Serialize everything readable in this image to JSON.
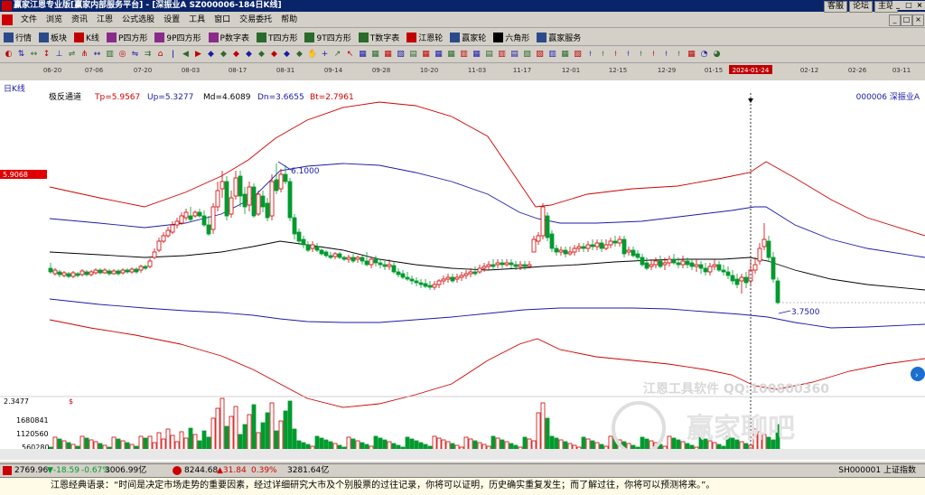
{
  "window": {
    "title": "赢家江恩专业版[赢家内部服务平台] - [深振业A  SZ000006-184日K线]",
    "links": [
      "客服",
      "论坛",
      "主站"
    ],
    "controls": [
      "_",
      "□",
      "×"
    ]
  },
  "menu": {
    "items": [
      "文件",
      "浏览",
      "资讯",
      "江恩",
      "公式选股",
      "设置",
      "工具",
      "窗口",
      "交易委托",
      "帮助"
    ],
    "doc_controls": [
      "_",
      "□",
      "×"
    ]
  },
  "toolbar": {
    "items": [
      {
        "label": "行情",
        "icon": "list-icon",
        "color": "#2b4a8a"
      },
      {
        "label": "板块",
        "icon": "grid-icon",
        "color": "#2b4a8a"
      },
      {
        "label": "K线",
        "icon": "candle-icon",
        "color": "#c00000"
      },
      {
        "label": "P四方形",
        "icon": "p-square-icon",
        "color": "#8a2b8a"
      },
      {
        "label": "9P四方形",
        "icon": "9p-square-icon",
        "color": "#8a2b8a"
      },
      {
        "label": "P数字表",
        "icon": "p-table-icon",
        "color": "#8a2b8a"
      },
      {
        "label": "T四方形",
        "icon": "t-square-icon",
        "color": "#2b6a2b"
      },
      {
        "label": "9T四方形",
        "icon": "9t-square-icon",
        "color": "#2b6a2b"
      },
      {
        "label": "T数字表",
        "icon": "t-table-icon",
        "color": "#2b6a2b"
      },
      {
        "label": "江恩轮",
        "icon": "gann-wheel-icon",
        "color": "#c00000"
      },
      {
        "label": "赢家轮",
        "icon": "winner-wheel-icon",
        "color": "#2b4a8a"
      },
      {
        "label": "六角形",
        "icon": "hexagon-icon",
        "color": "#000000"
      },
      {
        "label": "赢家服务",
        "icon": "service-icon",
        "color": "#2b4a8a"
      }
    ]
  },
  "date_axis": {
    "labels": [
      "06-20",
      "07-06",
      "07-20",
      "08-03",
      "08-17",
      "08-31",
      "09-14",
      "09-28",
      "10-20",
      "11-03",
      "11-17",
      "12-01",
      "12-15",
      "12-29",
      "01-15",
      "2024-01-24",
      "02-12",
      "02-26",
      "03-11"
    ],
    "highlight": "2024-01-24"
  },
  "indicator": {
    "period": "日K线",
    "name": "极反通道",
    "tp": "Tp=5.9567",
    "up": "Up=5.3277",
    "md": "Md=4.6089",
    "dn": "Dn=3.6655",
    "bt": "Bt=2.7961",
    "stock": "000006  深振业A"
  },
  "price_marker": "5.9068",
  "annotations": {
    "high": "6.1000",
    "low": "3.7500"
  },
  "volume": {
    "scale_top": "2.3477",
    "scale_mark": "$",
    "labels": [
      "1680841",
      "1120560",
      "560280"
    ]
  },
  "watermark": {
    "line1": "江恩工具软件  QQ:100800360",
    "line2": "赢家聊吧"
  },
  "status": {
    "sh_index": "2769.96",
    "sh_change": "▼-18.59",
    "sh_pct": "-0.67%",
    "sh_amount": "3006.99亿",
    "sz_index": "8244.68",
    "sz_change": "▲31.84",
    "sz_pct": "0.39%",
    "sz_amount": "3281.64亿",
    "right": "SH000001 上证指数"
  },
  "quote": "江恩经典语录：“时间是决定市场走势的重要因素，经过详细研究大市及个别股票的过往记录，你将可以证明，历史确实重复发生；而了解过往，你将可以预测将来。”。",
  "colors": {
    "up_candle": "#d00000",
    "down_candle": "#009a2e",
    "upper_band": "#d00000",
    "mid_band": "#1a1aa8",
    "md_line": "#000000",
    "title_bg": "#0a246a"
  }
}
